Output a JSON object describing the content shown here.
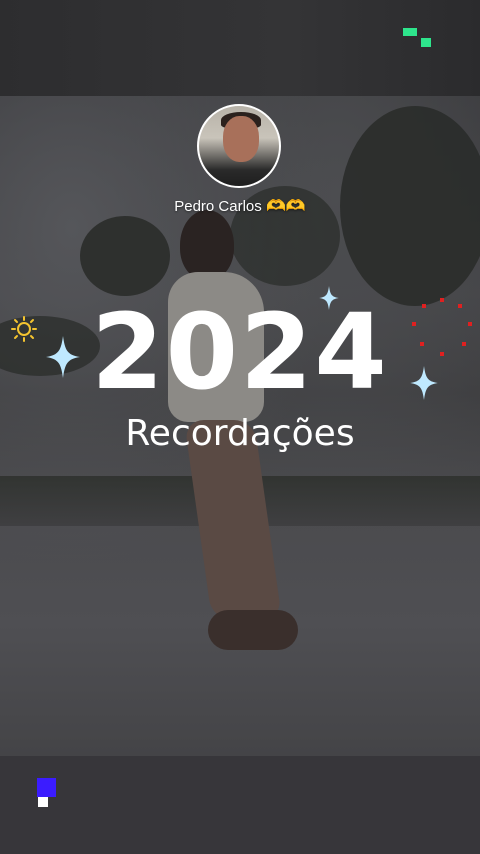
{
  "story": {
    "author_name": "Pedro Carlos",
    "author_emoji": "🫶🫶",
    "year": "2024",
    "subtitle": "Recordações"
  },
  "icons": {
    "top_right_marker": "pixel-blocks-icon",
    "bottom_left_marker": "pixel-blocks-icon",
    "sparkles": [
      "sparkle-icon",
      "sparkle-icon",
      "sparkle-icon"
    ],
    "sun_decoration": "sun-icon",
    "dotted_circle": "dotted-circle-icon"
  },
  "colors": {
    "green_marker": "#2ee58c",
    "blue_marker": "#3b1cff",
    "sparkle": "#bfe9ff",
    "sun": "#f4c430",
    "dots": "#e02020",
    "text": "#ffffff"
  }
}
